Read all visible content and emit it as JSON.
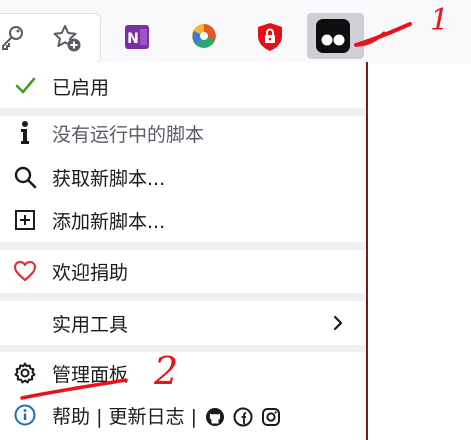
{
  "toolbar": {
    "icons": [
      "key-icon",
      "star-add-icon",
      "onenote-icon",
      "pie-chart-icon",
      "shield-lock-icon",
      "tampermonkey-icon"
    ],
    "onenote_letter": "N"
  },
  "menu": {
    "enabled_label": "已启用",
    "no_scripts_label": "没有运行中的脚本",
    "get_scripts_label": "获取新脚本...",
    "add_script_label": "添加新脚本...",
    "donate_label": "欢迎捐助",
    "utilities_label": "实用工具",
    "dashboard_label": "管理面板",
    "help_label": "帮助",
    "divider": "|",
    "changelog_label": "更新日志"
  },
  "annotations": {
    "mark_1": "1",
    "mark_2": "2",
    "color": "#e8141c"
  },
  "colors": {
    "check": "#4c9a2a",
    "heart": "#d9363e",
    "info": "#1a6fb5",
    "shield": "#e3101c",
    "onenote": "#7b2fa6"
  }
}
